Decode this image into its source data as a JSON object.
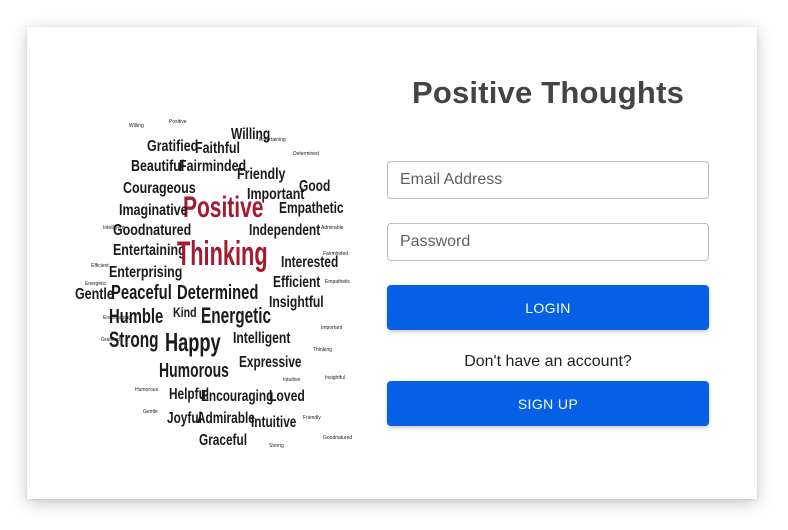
{
  "app": {
    "title": "Positive Thoughts"
  },
  "image": {
    "icon": "head-word-cloud-image",
    "accent_color": "#a6192e",
    "text_color": "#1a1a1a",
    "words": [
      "Willing",
      "Gratified",
      "Faithful",
      "Beautiful",
      "Fairminded",
      "Friendly",
      "Courageous",
      "Positive",
      "Important",
      "Good",
      "Imaginative",
      "Empathetic",
      "Goodnatured",
      "Independent",
      "Entertaining",
      "Thinking",
      "Interested",
      "Enterprising",
      "Efficient",
      "Gentle",
      "Peaceful",
      "Determined",
      "Insightful",
      "Humble",
      "Kind",
      "Energetic",
      "Strong",
      "Happy",
      "Intelligent",
      "Humorous",
      "Expressive",
      "Helpful",
      "Encouraging",
      "Loved",
      "Joyful",
      "Admirable",
      "Intuitive",
      "Graceful"
    ]
  },
  "form": {
    "email_placeholder": "Email Address",
    "password_placeholder": "Password",
    "login_label": "LOGIN",
    "prompt_text": "Don't have an account?",
    "signup_label": "SIGN UP"
  },
  "colors": {
    "primary": "#0560e6",
    "title": "#444444",
    "border": "#bdbdbd"
  }
}
